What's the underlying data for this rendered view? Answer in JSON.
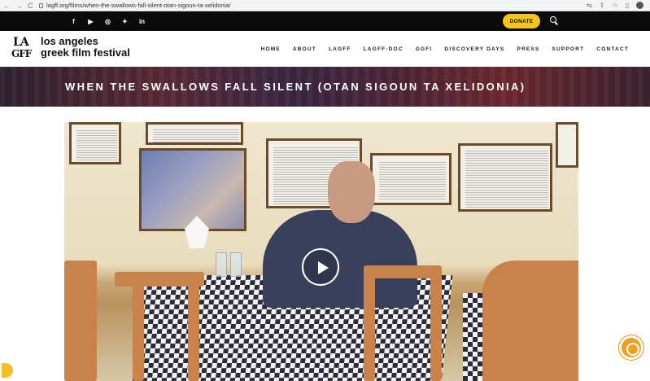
{
  "browser": {
    "url": "lagff.org/films/when-the-swallows-fall-silent-otan-sigoun-ta-xelidonia/",
    "back_glyph": "←",
    "forward_glyph": "→",
    "reload_glyph": "C",
    "tool_icons": [
      "translate-icon",
      "share-icon",
      "bookmark-icon",
      "sidepanel-icon",
      "profile-icon",
      "menu-icon"
    ]
  },
  "topbar": {
    "social": [
      {
        "icon": "facebook-icon",
        "glyph": "f"
      },
      {
        "icon": "youtube-icon",
        "glyph": "▶"
      },
      {
        "icon": "instagram-icon",
        "glyph": "◎"
      },
      {
        "icon": "twitter-icon",
        "glyph": "✦"
      },
      {
        "icon": "linkedin-icon",
        "glyph": "in"
      }
    ],
    "donate_label": "DONATE"
  },
  "header": {
    "logo_la": "LA",
    "logo_gff": "GFF",
    "site_name_line1": "los angeles",
    "site_name_line2": "greek film festival",
    "menu": [
      "HOME",
      "ABOUT",
      "LAGFF",
      "LAGFF-DOC",
      "GGFI",
      "DISCOVERY DAYS",
      "PRESS",
      "SUPPORT",
      "CONTACT"
    ]
  },
  "banner": {
    "title": "WHEN THE SWALLOWS FALL SILENT (OTAN SIGOUN TA XELIDONIA)"
  },
  "video": {
    "play_icon": "play-icon"
  },
  "colors": {
    "donate": "#f5c518",
    "topbar": "#0b0b0b",
    "accessibility": "#f0a020"
  }
}
